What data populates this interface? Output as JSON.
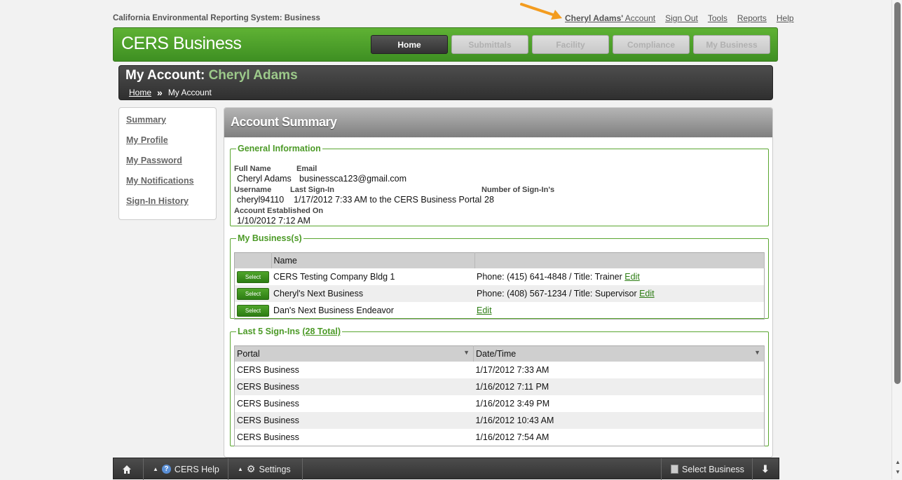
{
  "top": {
    "system_title": "California Environmental Reporting System: Business",
    "account_name": "Cheryl Adams'",
    "account_suffix": "Account",
    "links": [
      "Sign Out",
      "Tools",
      "Reports",
      "Help"
    ]
  },
  "header": {
    "app_name": "CERS Business",
    "nav": [
      "Home",
      "Submittals",
      "Facility",
      "Compliance",
      "My Business"
    ]
  },
  "title_bar": {
    "prefix": "My Account:",
    "user": "Cheryl Adams",
    "breadcrumb_home": "Home",
    "breadcrumb_sep": "»",
    "breadcrumb_current": "My Account"
  },
  "sidebar": {
    "items": [
      "Summary",
      "My Profile",
      "My Password",
      "My Notifications",
      "Sign-In History"
    ]
  },
  "main": {
    "title": "Account Summary",
    "general": {
      "legend": "General Information",
      "full_name_label": "Full Name",
      "full_name": "Cheryl Adams",
      "email_label": "Email",
      "email": "businessca123@gmail.com",
      "username_label": "Username",
      "username": "cheryl94110",
      "last_signin_label": "Last Sign-In",
      "last_signin": "1/17/2012 7:33 AM to the CERS Business Portal",
      "num_signins_label": "Number of Sign-In's",
      "num_signins": "28",
      "established_label": "Account Established On",
      "established": "1/10/2012 7:12 AM"
    },
    "businesses": {
      "legend": "My Business(s)",
      "col_name": "Name",
      "select_label": "Select",
      "edit_label": "Edit",
      "rows": [
        {
          "name": "CERS Testing Company Bldg 1",
          "info": "Phone: (415) 641-4848 / Title: Trainer"
        },
        {
          "name": "Cheryl's Next Business",
          "info": "Phone: (408) 567-1234 / Title: Supervisor"
        },
        {
          "name": "Dan's Next Business Endeavor",
          "info": ""
        }
      ]
    },
    "signins": {
      "legend": "Last 5 Sign-Ins",
      "total_link": "(28 Total)",
      "col_portal": "Portal",
      "col_datetime": "Date/Time",
      "rows": [
        {
          "portal": "CERS Business",
          "datetime": "1/17/2012 7:33 AM"
        },
        {
          "portal": "CERS Business",
          "datetime": "1/16/2012 7:11 PM"
        },
        {
          "portal": "CERS Business",
          "datetime": "1/16/2012 3:49 PM"
        },
        {
          "portal": "CERS Business",
          "datetime": "1/16/2012 10:43 AM"
        },
        {
          "portal": "CERS Business",
          "datetime": "1/16/2012 7:54 AM"
        }
      ]
    }
  },
  "bottom_bar": {
    "help_label": "CERS Help",
    "settings_label": "Settings",
    "select_business_label": "Select Business"
  },
  "icons": {
    "home": "home-icon",
    "help": "help-icon",
    "settings": "gear-icon",
    "collapse": "double-chevron-down-icon",
    "pointer": "orange-arrow-icon"
  },
  "colors": {
    "brand_green": "#4c9a27",
    "header_dark": "#333333",
    "accent_orange": "#f39c1f"
  }
}
